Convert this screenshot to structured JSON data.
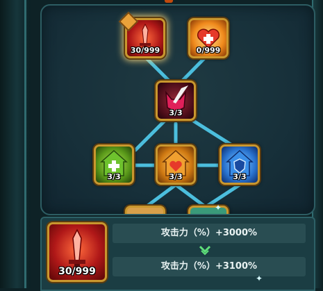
{
  "tree": {
    "nodes": {
      "attack_sword": {
        "count": "30/999",
        "icon": "red-sword-icon",
        "selected": true
      },
      "hp_heart": {
        "count": "0/999",
        "icon": "heart-plus-icon"
      },
      "demon_slash": {
        "count": "3/3",
        "icon": "demon-mask-sword-icon"
      },
      "green_heal": {
        "count": "3/3",
        "icon": "green-house-plus-icon"
      },
      "orange_heart_house": {
        "count": "3/3",
        "icon": "orange-house-heart-icon"
      },
      "blue_shield": {
        "count": "3/3",
        "icon": "blue-house-shield-icon"
      }
    }
  },
  "detail": {
    "icon_count": "30/999",
    "current_stat": "攻击力（%）+3000%",
    "next_stat": "攻击力（%）+3100%"
  },
  "colors": {
    "gold_border": "#c9972e",
    "link": "#4fc6e6",
    "panel": "#1b3d43"
  }
}
